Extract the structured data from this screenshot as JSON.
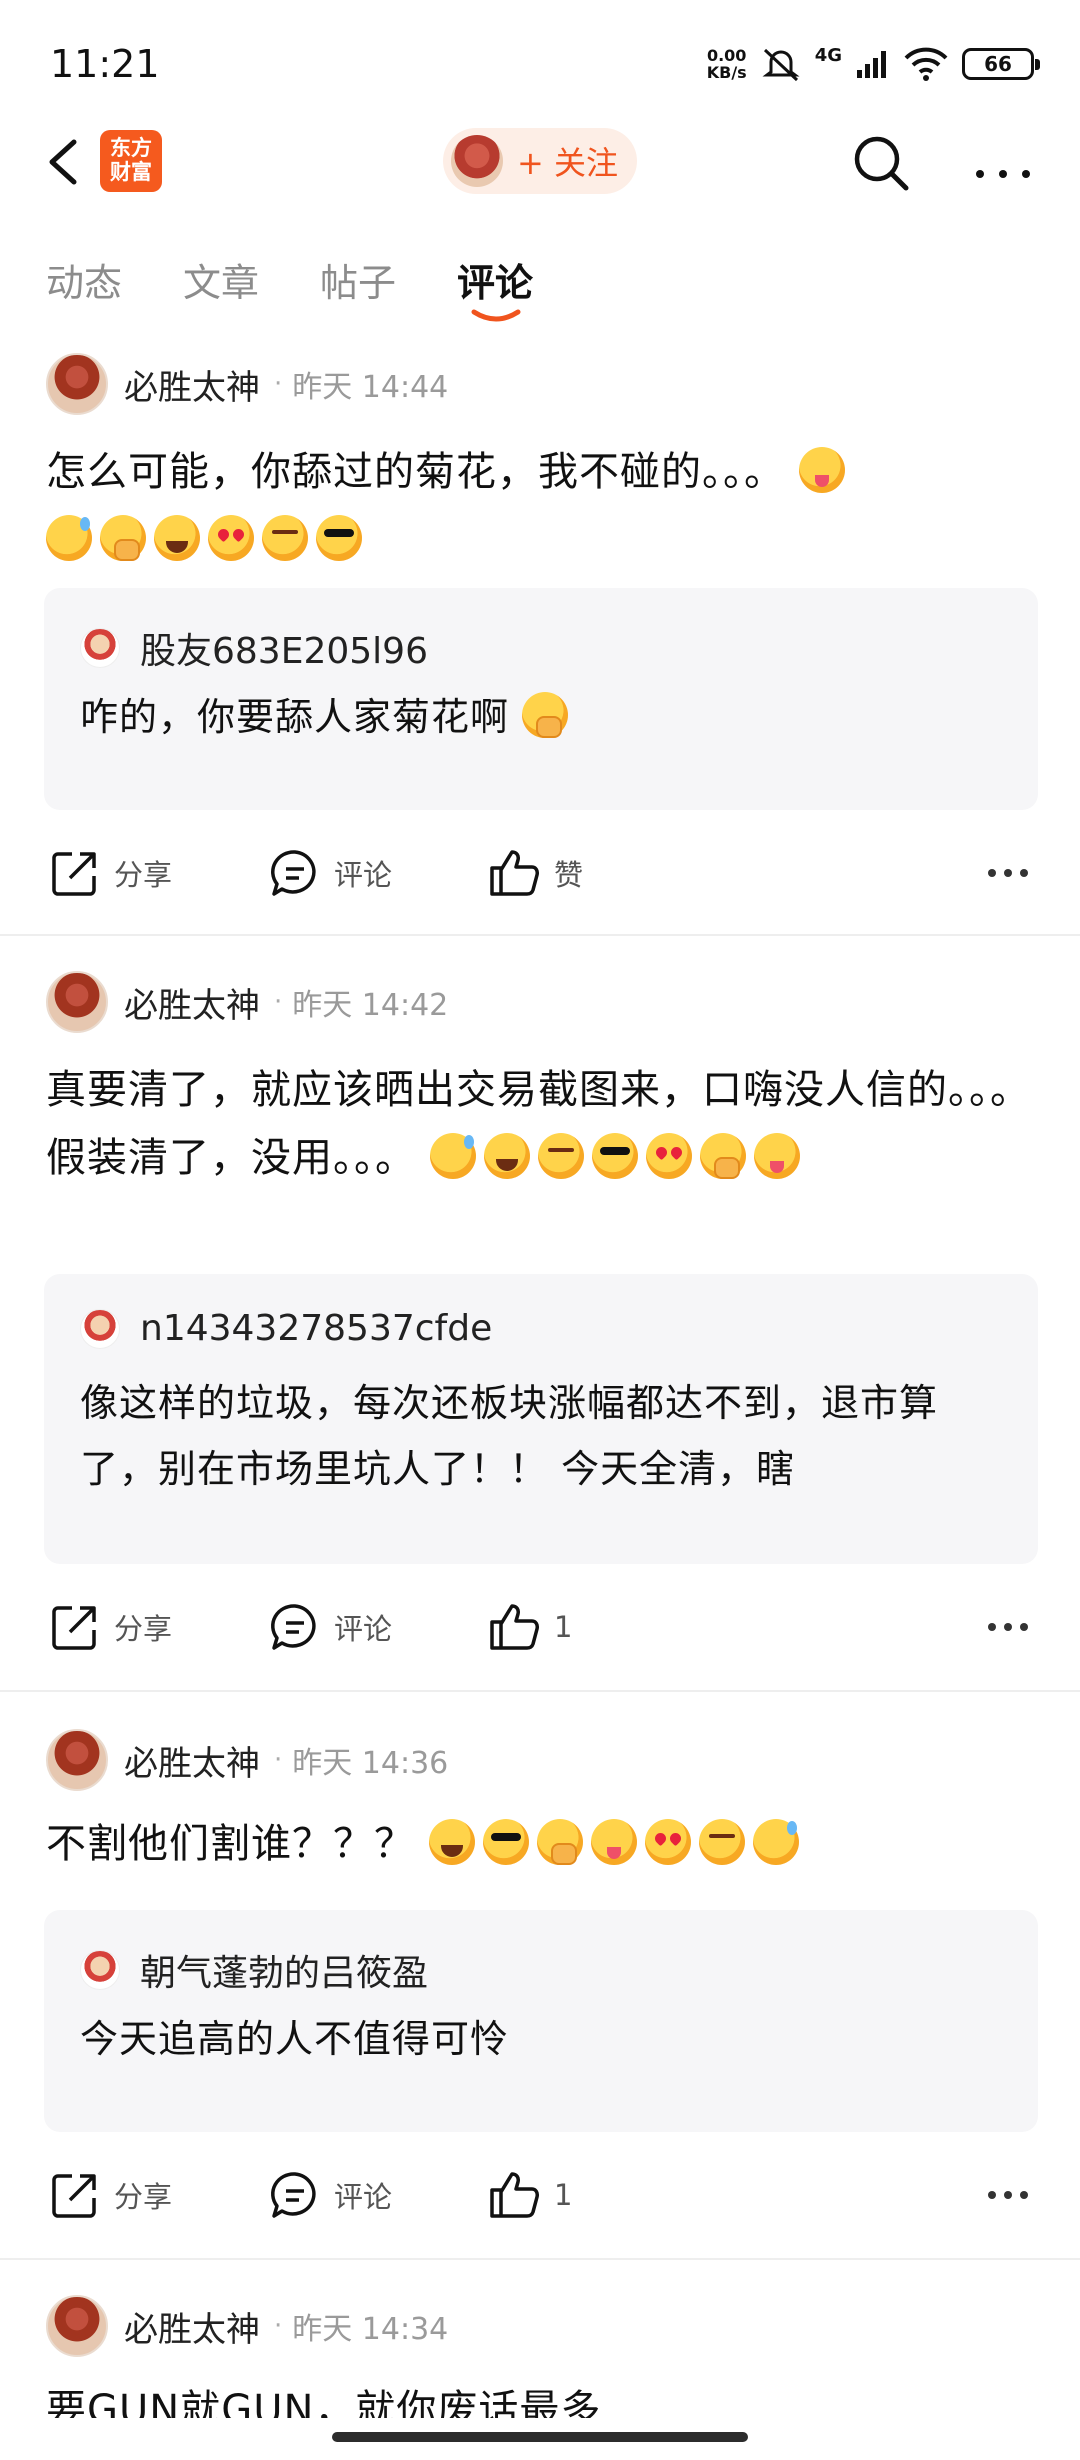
{
  "status_bar": {
    "time": "11:21",
    "net_speed_value": "0.00",
    "net_speed_unit": "KB/s",
    "network_type": "4G",
    "battery_level": "66"
  },
  "nav": {
    "logo_line1": "东方",
    "logo_line2": "财富",
    "follow_label": "+ 关注"
  },
  "tabs": [
    {
      "label": "动态",
      "active": false
    },
    {
      "label": "文章",
      "active": false
    },
    {
      "label": "帖子",
      "active": false
    },
    {
      "label": "评论",
      "active": true
    }
  ],
  "posts": [
    {
      "author": "必胜太神",
      "time": "昨天 14:44",
      "text": "怎么可能，你舔过的菊花，我不碰的。。。",
      "quote_user": "股友683E205l96",
      "quote_text": "咋的，你要舔人家菊花啊",
      "share_label": "分享",
      "comment_label": "评论",
      "like_label": "赞"
    },
    {
      "author": "必胜太神",
      "time": "昨天 14:42",
      "text": "真要清了，就应该晒出交易截图来，口嗨没人信的。。。假装清了，没用。。。",
      "quote_user": "n14343278537cfde",
      "quote_text": "像这样的垃圾，每次还板块涨幅都达不到，退市算了，别在市场里坑人了！！ 今天全清，瞎",
      "share_label": "分享",
      "comment_label": "评论",
      "like_label": "1"
    },
    {
      "author": "必胜太神",
      "time": "昨天 14:36",
      "text": "不割他们割谁？？？",
      "quote_user": "朝气蓬勃的吕筱盈",
      "quote_text": "今天追高的人不值得可怜",
      "share_label": "分享",
      "comment_label": "评论",
      "like_label": "1"
    },
    {
      "author": "必胜太神",
      "time": "昨天 14:34",
      "text": "要GUN就GUN，就你废话最多"
    }
  ]
}
